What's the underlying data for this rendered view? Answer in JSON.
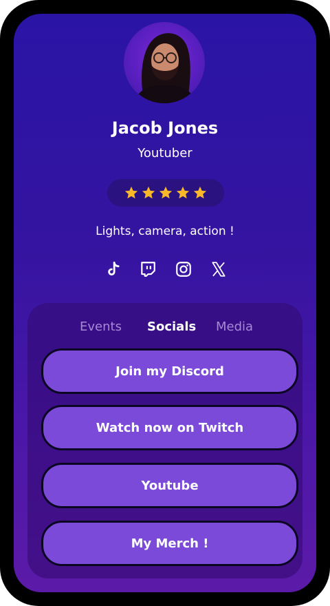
{
  "profile": {
    "name": "Jacob Jones",
    "role": "Youtuber",
    "bio": "Lights, camera, action !",
    "rating": 5,
    "rating_max": 5
  },
  "social_icons": [
    "tiktok-icon",
    "twitch-icon",
    "instagram-icon",
    "x-icon"
  ],
  "tabs": [
    {
      "label": "Events",
      "active": false
    },
    {
      "label": "Socials",
      "active": true
    },
    {
      "label": "Media",
      "active": false
    }
  ],
  "links": [
    {
      "label": "Join my Discord"
    },
    {
      "label": "Watch now on Twitch"
    },
    {
      "label": "Youtube"
    },
    {
      "label": "My Merch !"
    }
  ],
  "colors": {
    "background_top": "#2a14a6",
    "background_bottom": "#5c1aa8",
    "button": "#7b4ad8",
    "star": "#fbb92a",
    "tab_inactive": "#a78ad6"
  }
}
